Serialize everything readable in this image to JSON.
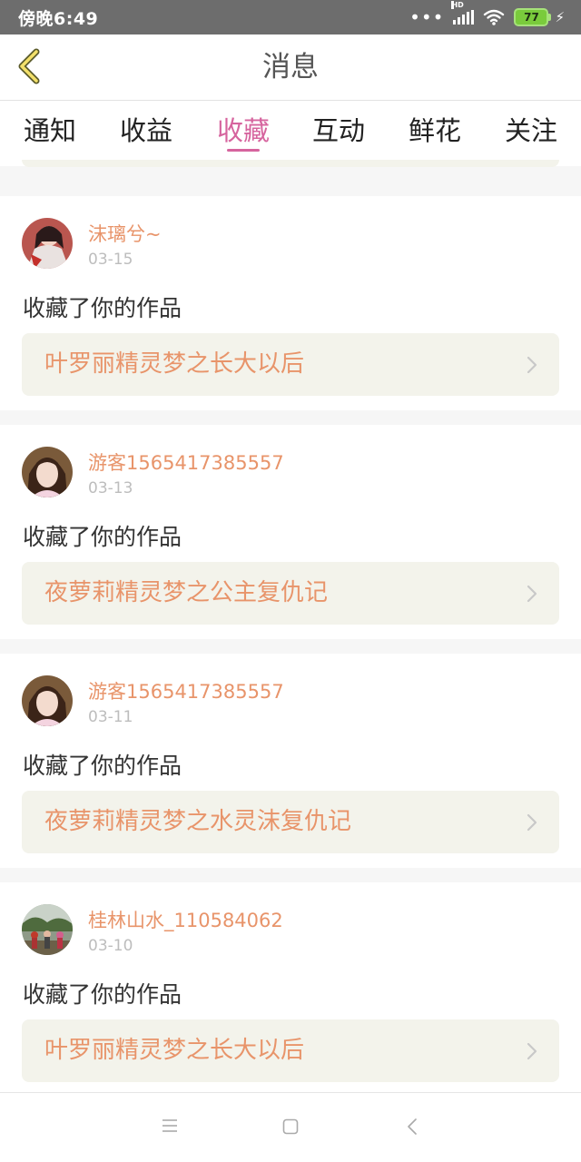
{
  "status_bar": {
    "time": "傍晚6:49",
    "network_label": "HD",
    "battery_level": "77",
    "battery_color": "#7acb3c"
  },
  "header": {
    "title": "消息",
    "back_icon": "chevron-left-icon"
  },
  "tabs": [
    {
      "label": "通知",
      "active": false
    },
    {
      "label": "收益",
      "active": false
    },
    {
      "label": "收藏",
      "active": true
    },
    {
      "label": "互动",
      "active": false
    },
    {
      "label": "鲜花",
      "active": false
    },
    {
      "label": "关注",
      "active": false
    }
  ],
  "accent_color": "#d6649e",
  "name_color": "#e8946a",
  "messages": [
    {
      "username": "沫璃兮~",
      "date": "03-15",
      "action": "收藏了你的作品",
      "work_title": "叶罗丽精灵梦之长大以后"
    },
    {
      "username": "游客1565417385557",
      "date": "03-13",
      "action": "收藏了你的作品",
      "work_title": "夜萝莉精灵梦之公主复仇记"
    },
    {
      "username": "游客1565417385557",
      "date": "03-11",
      "action": "收藏了你的作品",
      "work_title": "夜萝莉精灵梦之水灵沫复仇记"
    },
    {
      "username": "桂林山水_110584062",
      "date": "03-10",
      "action": "收藏了你的作品",
      "work_title": "叶罗丽精灵梦之长大以后"
    }
  ],
  "nav_bar": {
    "menu_icon": "menu-icon",
    "home_icon": "home-square-icon",
    "back_icon": "back-triangle-icon"
  }
}
